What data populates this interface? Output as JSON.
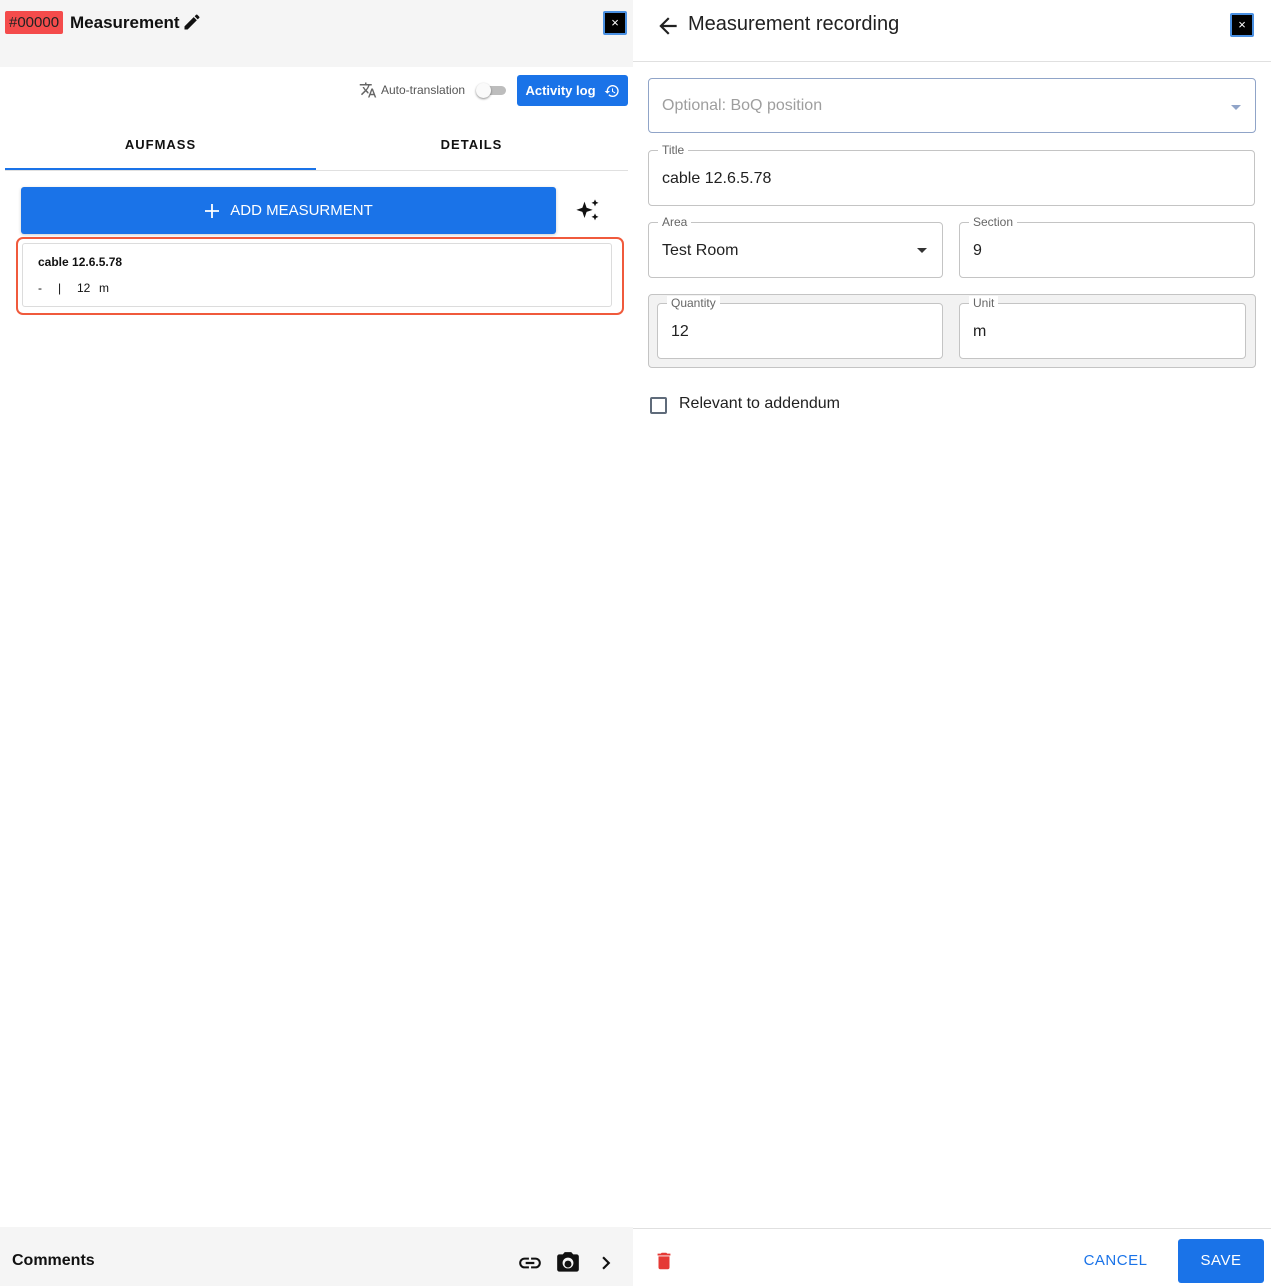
{
  "left": {
    "ticket_id": "#00000",
    "title": "Measurement",
    "close_label": "×",
    "auto_translation_label": "Auto-translation",
    "auto_translation_on": false,
    "activity_log_label": "Activity log",
    "tabs": [
      {
        "label": "AUFMASS",
        "active": true
      },
      {
        "label": "DETAILS",
        "active": false
      }
    ],
    "add_button_label": "ADD MEASURMENT",
    "measurements": [
      {
        "title": "cable 12.6.5.78",
        "section": "-",
        "separator": "|",
        "quantity": "12",
        "unit": "m"
      }
    ],
    "comments_label": "Comments"
  },
  "right": {
    "title": "Measurement recording",
    "close_label": "×",
    "boq_placeholder": "Optional: BoQ position",
    "fields": {
      "title": {
        "label": "Title",
        "value": "cable 12.6.5.78"
      },
      "area": {
        "label": "Area",
        "value": "Test Room"
      },
      "section": {
        "label": "Section",
        "value": "9"
      },
      "quantity": {
        "label": "Quantity",
        "value": "12"
      },
      "unit": {
        "label": "Unit",
        "value": "m"
      }
    },
    "addendum_label": "Relevant to addendum",
    "addendum_checked": false,
    "cancel_label": "CANCEL",
    "save_label": "SAVE"
  },
  "colors": {
    "primary": "#1a73e8",
    "ticket_badge": "#f44b4b",
    "highlight_outline": "#f05a3c",
    "delete": "#e53935"
  },
  "icons": [
    "edit-icon",
    "close-icon",
    "translate-icon",
    "history-icon",
    "plus-icon",
    "sparkle-icon",
    "link-icon",
    "camera-icon",
    "chevron-right-icon",
    "arrow-back-icon",
    "dropdown-caret-icon",
    "trash-icon"
  ]
}
